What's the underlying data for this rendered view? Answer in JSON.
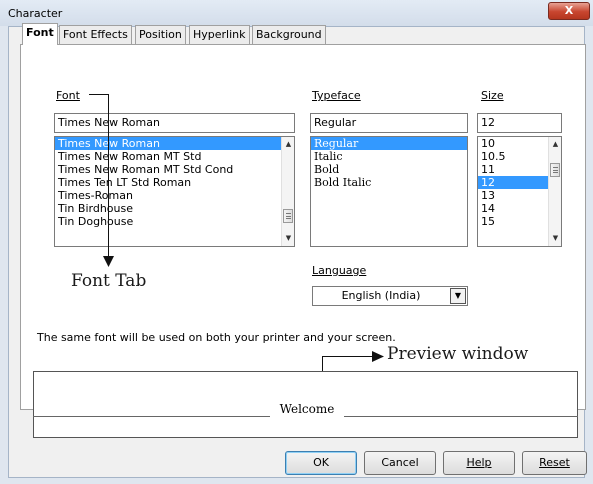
{
  "window": {
    "title": "Character",
    "close_glyph": "X"
  },
  "tabs": [
    "Font",
    "Font Effects",
    "Position",
    "Hyperlink",
    "Background"
  ],
  "font": {
    "label": "Font",
    "value": "Times New Roman",
    "list": [
      "Times New Roman",
      "Times New Roman MT Std",
      "Times New Roman MT Std Cond",
      "Times Ten LT Std Roman",
      "Times-Roman",
      "Tin Birdhouse",
      "Tin Doghouse"
    ],
    "selected_index": 0
  },
  "typeface": {
    "label": "Typeface",
    "value": "Regular",
    "list": [
      "Regular",
      "Italic",
      "Bold",
      "Bold Italic"
    ],
    "selected_index": 0
  },
  "size": {
    "label": "Size",
    "value": "12",
    "list": [
      "10",
      "10.5",
      "11",
      "12",
      "13",
      "14",
      "15"
    ],
    "selected_index": 3
  },
  "language": {
    "label": "Language",
    "value": "English (India)"
  },
  "info_text": "The same font will be used on both your printer and your screen.",
  "preview": {
    "text": "Welcome"
  },
  "annotations": {
    "font_tab": "Font Tab",
    "preview_window": "Preview window"
  },
  "buttons": {
    "ok": "OK",
    "cancel": "Cancel",
    "help": "Help",
    "reset": "Reset"
  }
}
